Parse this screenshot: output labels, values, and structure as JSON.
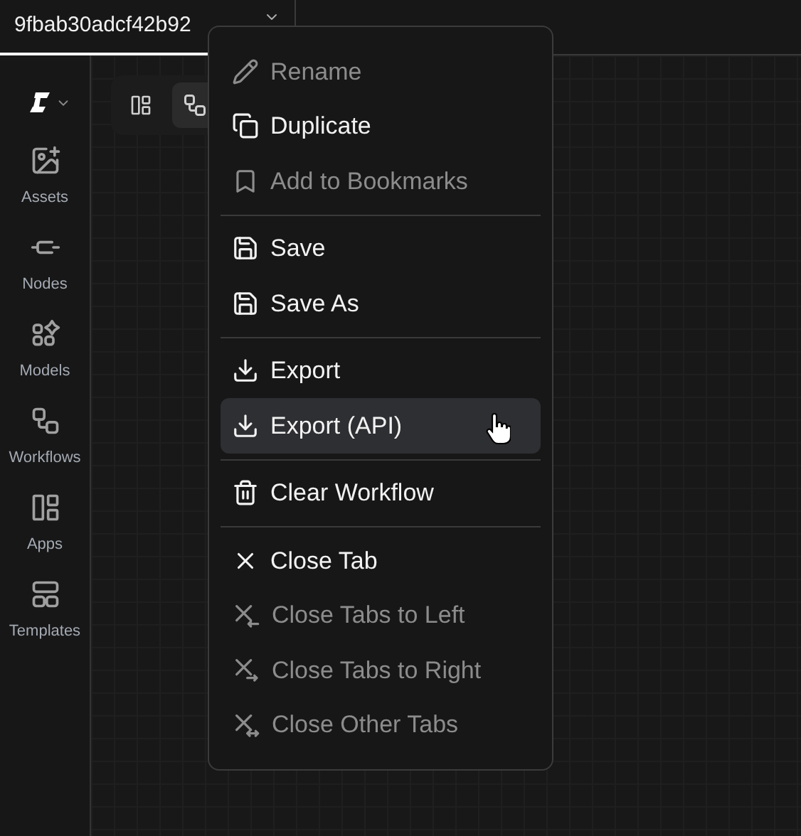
{
  "tab": {
    "title": "9fbab30adcf42b92",
    "selected": true
  },
  "sidebar": {
    "items": [
      {
        "label": "Assets",
        "selected": false
      },
      {
        "label": "Nodes",
        "selected": false
      },
      {
        "label": "Models",
        "selected": false
      },
      {
        "label": "Workflows",
        "selected": false
      },
      {
        "label": "Apps",
        "selected": false
      },
      {
        "label": "Templates",
        "selected": false
      }
    ]
  },
  "toolbar": [
    {
      "selected": false
    },
    {
      "selected": true
    }
  ],
  "context_menu": {
    "sections": [
      [
        {
          "label": "Rename",
          "disabled": true,
          "selected": false
        },
        {
          "label": "Duplicate",
          "disabled": false,
          "selected": false
        },
        {
          "label": "Add to Bookmarks",
          "disabled": true,
          "selected": false
        }
      ],
      [
        {
          "label": "Save",
          "disabled": false,
          "selected": false
        },
        {
          "label": "Save As",
          "disabled": false,
          "selected": false
        }
      ],
      [
        {
          "label": "Export",
          "disabled": false,
          "selected": false
        },
        {
          "label": "Export (API)",
          "disabled": false,
          "selected": true
        }
      ],
      [
        {
          "label": "Clear Workflow",
          "disabled": false,
          "selected": false
        }
      ],
      [
        {
          "label": "Close Tab",
          "disabled": false,
          "selected": false
        },
        {
          "label": "Close Tabs to Left",
          "disabled": true,
          "selected": false
        },
        {
          "label": "Close Tabs to Right",
          "disabled": true,
          "selected": false
        },
        {
          "label": "Close Other Tabs",
          "disabled": true,
          "selected": false
        }
      ]
    ]
  }
}
